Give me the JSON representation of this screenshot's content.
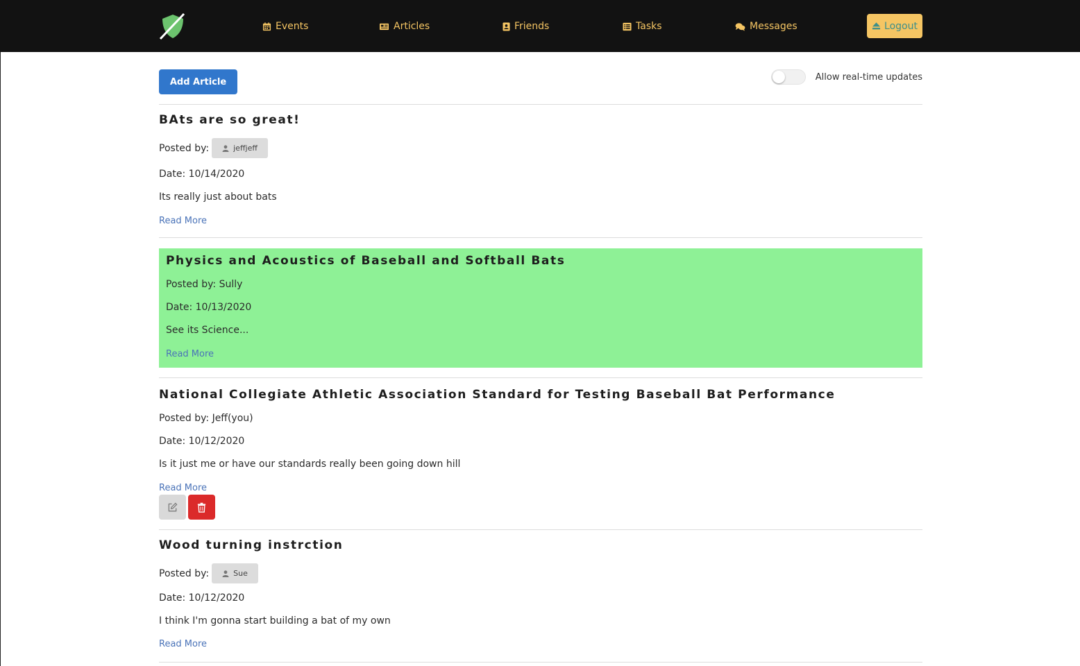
{
  "nav": {
    "logo_icon": "shield-slash-icon",
    "items": [
      {
        "label": "Events",
        "icon": "calendar-icon"
      },
      {
        "label": "Articles",
        "icon": "newspaper-icon"
      },
      {
        "label": "Friends",
        "icon": "address-book-icon"
      },
      {
        "label": "Tasks",
        "icon": "list-icon"
      },
      {
        "label": "Messages",
        "icon": "comments-icon"
      }
    ],
    "logout_label": "Logout",
    "logout_icon": "eject-icon"
  },
  "toolbar": {
    "add_article_label": "Add Article",
    "realtime_label": "Allow real-time updates",
    "realtime_enabled": false
  },
  "articles": [
    {
      "title": "BAts are so great!",
      "posted_by_label": "Posted by:",
      "author": "jeffjeff",
      "date": "Date: 10/14/2020",
      "summary": "Its really just about bats",
      "read_more": "Read More"
    },
    {
      "title": "Physics and Acoustics of Baseball and Softball Bats",
      "posted_by": "Posted by: Sully",
      "date": "Date: 10/13/2020",
      "summary": "See its Science...",
      "read_more": "Read More",
      "highlighted": true
    },
    {
      "title": "National Collegiate Athletic Association Standard for Testing Baseball Bat Performance",
      "posted_by": "Posted by: Jeff(you)",
      "date": "Date: 10/12/2020",
      "summary": "Is it just me or have our standards really been going down hill",
      "read_more": "Read More"
    },
    {
      "title": "Wood turning instrction",
      "posted_by_label": "Posted by:",
      "author": "Sue",
      "date": "Date: 10/12/2020",
      "summary": "I think I'm gonna start building a bat of my own",
      "read_more": "Read More"
    }
  ],
  "colors": {
    "navbar_bg": "#121212",
    "nav_accent": "#f5c563",
    "logout_text": "#3d8f8a",
    "primary_button": "#3177cc",
    "highlight_bg": "#8ef196",
    "link": "#4a73b8",
    "delete_button": "#db2a2a",
    "logo_green": "#6cc36e"
  }
}
